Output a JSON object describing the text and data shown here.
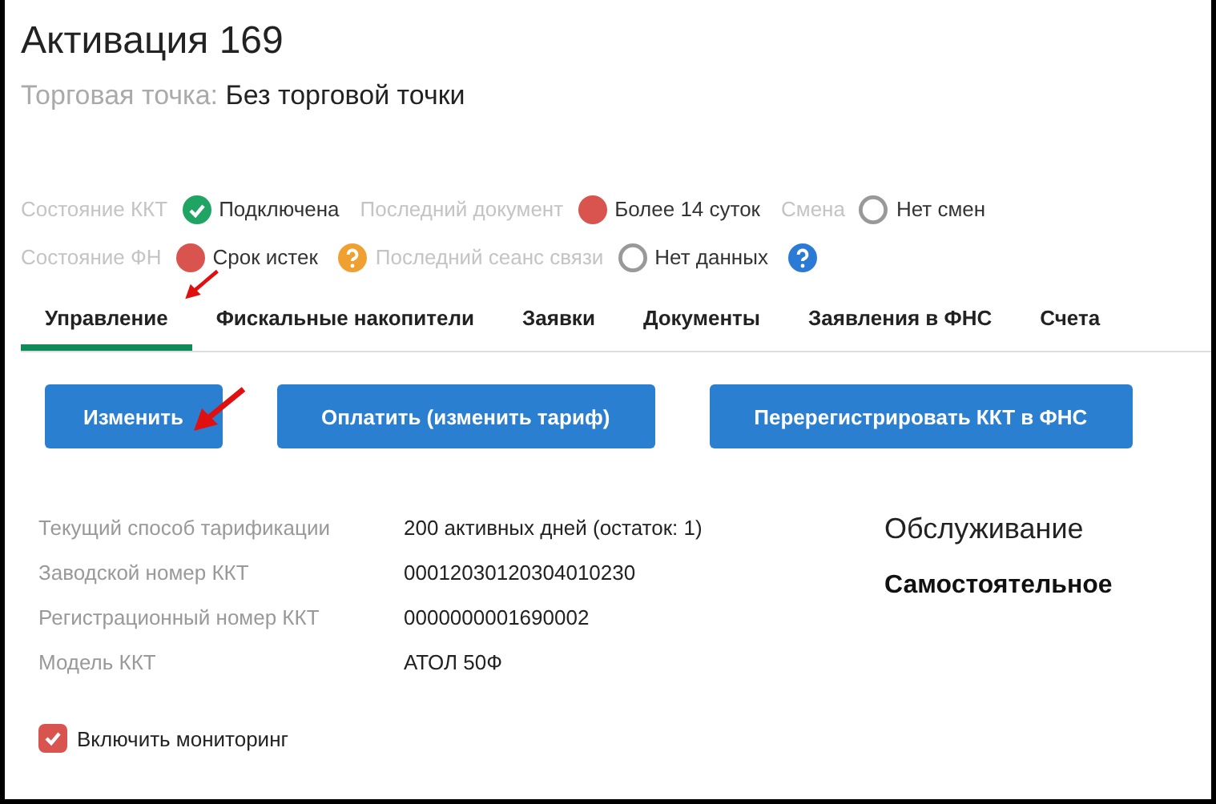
{
  "title": "Активация 169",
  "subtitle": {
    "label": "Торговая точка:",
    "value": "Без торговой точки"
  },
  "status_rows": [
    [
      {
        "kind": "label",
        "text": "Состояние ККТ"
      },
      {
        "kind": "ok",
        "text": "Подключена"
      },
      {
        "kind": "label",
        "text": "Последний документ"
      },
      {
        "kind": "error",
        "text": "Более 14 суток"
      },
      {
        "kind": "label",
        "text": "Смена"
      },
      {
        "kind": "none",
        "text": "Нет смен"
      }
    ],
    [
      {
        "kind": "label",
        "text": "Состояние ФН"
      },
      {
        "kind": "error",
        "text": "Срок истек"
      },
      {
        "kind": "help",
        "color": "#f0a030"
      },
      {
        "kind": "label",
        "text": "Последний сеанс связи"
      },
      {
        "kind": "none",
        "text": "Нет данных"
      },
      {
        "kind": "help",
        "color": "#2b7bd6"
      }
    ]
  ],
  "tabs": [
    {
      "label": "Управление",
      "selected": true
    },
    {
      "label": "Фискальные накопители",
      "selected": false
    },
    {
      "label": "Заявки",
      "selected": false
    },
    {
      "label": "Документы",
      "selected": false
    },
    {
      "label": "Заявления в ФНС",
      "selected": false
    },
    {
      "label": "Счета",
      "selected": false
    }
  ],
  "buttons": [
    "Изменить",
    "Оплатить (изменить тариф)",
    "Перерегистрировать ККТ в ФНС"
  ],
  "details": [
    {
      "label": "Текущий способ тарификации",
      "value": "200 активных дней (остаток: 1)"
    },
    {
      "label": "Заводской номер ККТ",
      "value": "00012030120304010230"
    },
    {
      "label": "Регистрационный номер ККТ",
      "value": "0000000001690002"
    },
    {
      "label": "Модель ККТ",
      "value": "АТОЛ 50Ф"
    }
  ],
  "service": {
    "heading": "Обслуживание",
    "value": "Самостоятельное"
  },
  "monitoring": {
    "label": "Включить мониторинг",
    "checked": true
  }
}
